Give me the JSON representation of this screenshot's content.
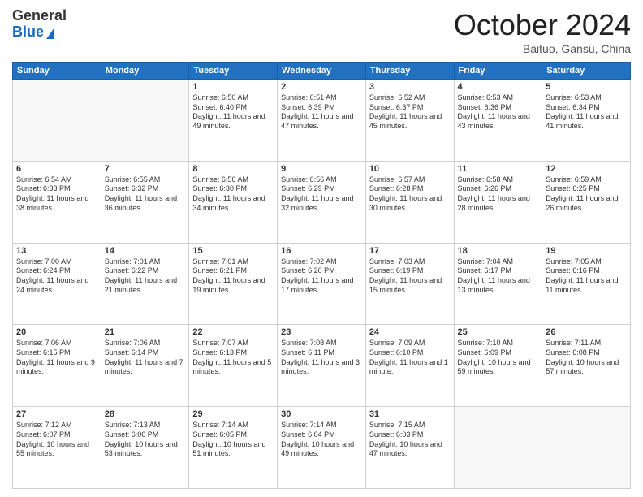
{
  "header": {
    "logo_general": "General",
    "logo_blue": "Blue",
    "title": "October 2024",
    "location": "Baituo, Gansu, China"
  },
  "days_of_week": [
    "Sunday",
    "Monday",
    "Tuesday",
    "Wednesday",
    "Thursday",
    "Friday",
    "Saturday"
  ],
  "weeks": [
    [
      {
        "day": "",
        "empty": true
      },
      {
        "day": "",
        "empty": true
      },
      {
        "day": "1",
        "sunrise": "Sunrise: 6:50 AM",
        "sunset": "Sunset: 6:40 PM",
        "daylight": "Daylight: 11 hours and 49 minutes."
      },
      {
        "day": "2",
        "sunrise": "Sunrise: 6:51 AM",
        "sunset": "Sunset: 6:39 PM",
        "daylight": "Daylight: 11 hours and 47 minutes."
      },
      {
        "day": "3",
        "sunrise": "Sunrise: 6:52 AM",
        "sunset": "Sunset: 6:37 PM",
        "daylight": "Daylight: 11 hours and 45 minutes."
      },
      {
        "day": "4",
        "sunrise": "Sunrise: 6:53 AM",
        "sunset": "Sunset: 6:36 PM",
        "daylight": "Daylight: 11 hours and 43 minutes."
      },
      {
        "day": "5",
        "sunrise": "Sunrise: 6:53 AM",
        "sunset": "Sunset: 6:34 PM",
        "daylight": "Daylight: 11 hours and 41 minutes."
      }
    ],
    [
      {
        "day": "6",
        "sunrise": "Sunrise: 6:54 AM",
        "sunset": "Sunset: 6:33 PM",
        "daylight": "Daylight: 11 hours and 38 minutes."
      },
      {
        "day": "7",
        "sunrise": "Sunrise: 6:55 AM",
        "sunset": "Sunset: 6:32 PM",
        "daylight": "Daylight: 11 hours and 36 minutes."
      },
      {
        "day": "8",
        "sunrise": "Sunrise: 6:56 AM",
        "sunset": "Sunset: 6:30 PM",
        "daylight": "Daylight: 11 hours and 34 minutes."
      },
      {
        "day": "9",
        "sunrise": "Sunrise: 6:56 AM",
        "sunset": "Sunset: 6:29 PM",
        "daylight": "Daylight: 11 hours and 32 minutes."
      },
      {
        "day": "10",
        "sunrise": "Sunrise: 6:57 AM",
        "sunset": "Sunset: 6:28 PM",
        "daylight": "Daylight: 11 hours and 30 minutes."
      },
      {
        "day": "11",
        "sunrise": "Sunrise: 6:58 AM",
        "sunset": "Sunset: 6:26 PM",
        "daylight": "Daylight: 11 hours and 28 minutes."
      },
      {
        "day": "12",
        "sunrise": "Sunrise: 6:59 AM",
        "sunset": "Sunset: 6:25 PM",
        "daylight": "Daylight: 11 hours and 26 minutes."
      }
    ],
    [
      {
        "day": "13",
        "sunrise": "Sunrise: 7:00 AM",
        "sunset": "Sunset: 6:24 PM",
        "daylight": "Daylight: 11 hours and 24 minutes."
      },
      {
        "day": "14",
        "sunrise": "Sunrise: 7:01 AM",
        "sunset": "Sunset: 6:22 PM",
        "daylight": "Daylight: 11 hours and 21 minutes."
      },
      {
        "day": "15",
        "sunrise": "Sunrise: 7:01 AM",
        "sunset": "Sunset: 6:21 PM",
        "daylight": "Daylight: 11 hours and 19 minutes."
      },
      {
        "day": "16",
        "sunrise": "Sunrise: 7:02 AM",
        "sunset": "Sunset: 6:20 PM",
        "daylight": "Daylight: 11 hours and 17 minutes."
      },
      {
        "day": "17",
        "sunrise": "Sunrise: 7:03 AM",
        "sunset": "Sunset: 6:19 PM",
        "daylight": "Daylight: 11 hours and 15 minutes."
      },
      {
        "day": "18",
        "sunrise": "Sunrise: 7:04 AM",
        "sunset": "Sunset: 6:17 PM",
        "daylight": "Daylight: 11 hours and 13 minutes."
      },
      {
        "day": "19",
        "sunrise": "Sunrise: 7:05 AM",
        "sunset": "Sunset: 6:16 PM",
        "daylight": "Daylight: 11 hours and 11 minutes."
      }
    ],
    [
      {
        "day": "20",
        "sunrise": "Sunrise: 7:06 AM",
        "sunset": "Sunset: 6:15 PM",
        "daylight": "Daylight: 11 hours and 9 minutes."
      },
      {
        "day": "21",
        "sunrise": "Sunrise: 7:06 AM",
        "sunset": "Sunset: 6:14 PM",
        "daylight": "Daylight: 11 hours and 7 minutes."
      },
      {
        "day": "22",
        "sunrise": "Sunrise: 7:07 AM",
        "sunset": "Sunset: 6:13 PM",
        "daylight": "Daylight: 11 hours and 5 minutes."
      },
      {
        "day": "23",
        "sunrise": "Sunrise: 7:08 AM",
        "sunset": "Sunset: 6:11 PM",
        "daylight": "Daylight: 11 hours and 3 minutes."
      },
      {
        "day": "24",
        "sunrise": "Sunrise: 7:09 AM",
        "sunset": "Sunset: 6:10 PM",
        "daylight": "Daylight: 11 hours and 1 minute."
      },
      {
        "day": "25",
        "sunrise": "Sunrise: 7:10 AM",
        "sunset": "Sunset: 6:09 PM",
        "daylight": "Daylight: 10 hours and 59 minutes."
      },
      {
        "day": "26",
        "sunrise": "Sunrise: 7:11 AM",
        "sunset": "Sunset: 6:08 PM",
        "daylight": "Daylight: 10 hours and 57 minutes."
      }
    ],
    [
      {
        "day": "27",
        "sunrise": "Sunrise: 7:12 AM",
        "sunset": "Sunset: 6:07 PM",
        "daylight": "Daylight: 10 hours and 55 minutes."
      },
      {
        "day": "28",
        "sunrise": "Sunrise: 7:13 AM",
        "sunset": "Sunset: 6:06 PM",
        "daylight": "Daylight: 10 hours and 53 minutes."
      },
      {
        "day": "29",
        "sunrise": "Sunrise: 7:14 AM",
        "sunset": "Sunset: 6:05 PM",
        "daylight": "Daylight: 10 hours and 51 minutes."
      },
      {
        "day": "30",
        "sunrise": "Sunrise: 7:14 AM",
        "sunset": "Sunset: 6:04 PM",
        "daylight": "Daylight: 10 hours and 49 minutes."
      },
      {
        "day": "31",
        "sunrise": "Sunrise: 7:15 AM",
        "sunset": "Sunset: 6:03 PM",
        "daylight": "Daylight: 10 hours and 47 minutes."
      },
      {
        "day": "",
        "empty": true
      },
      {
        "day": "",
        "empty": true
      }
    ]
  ]
}
